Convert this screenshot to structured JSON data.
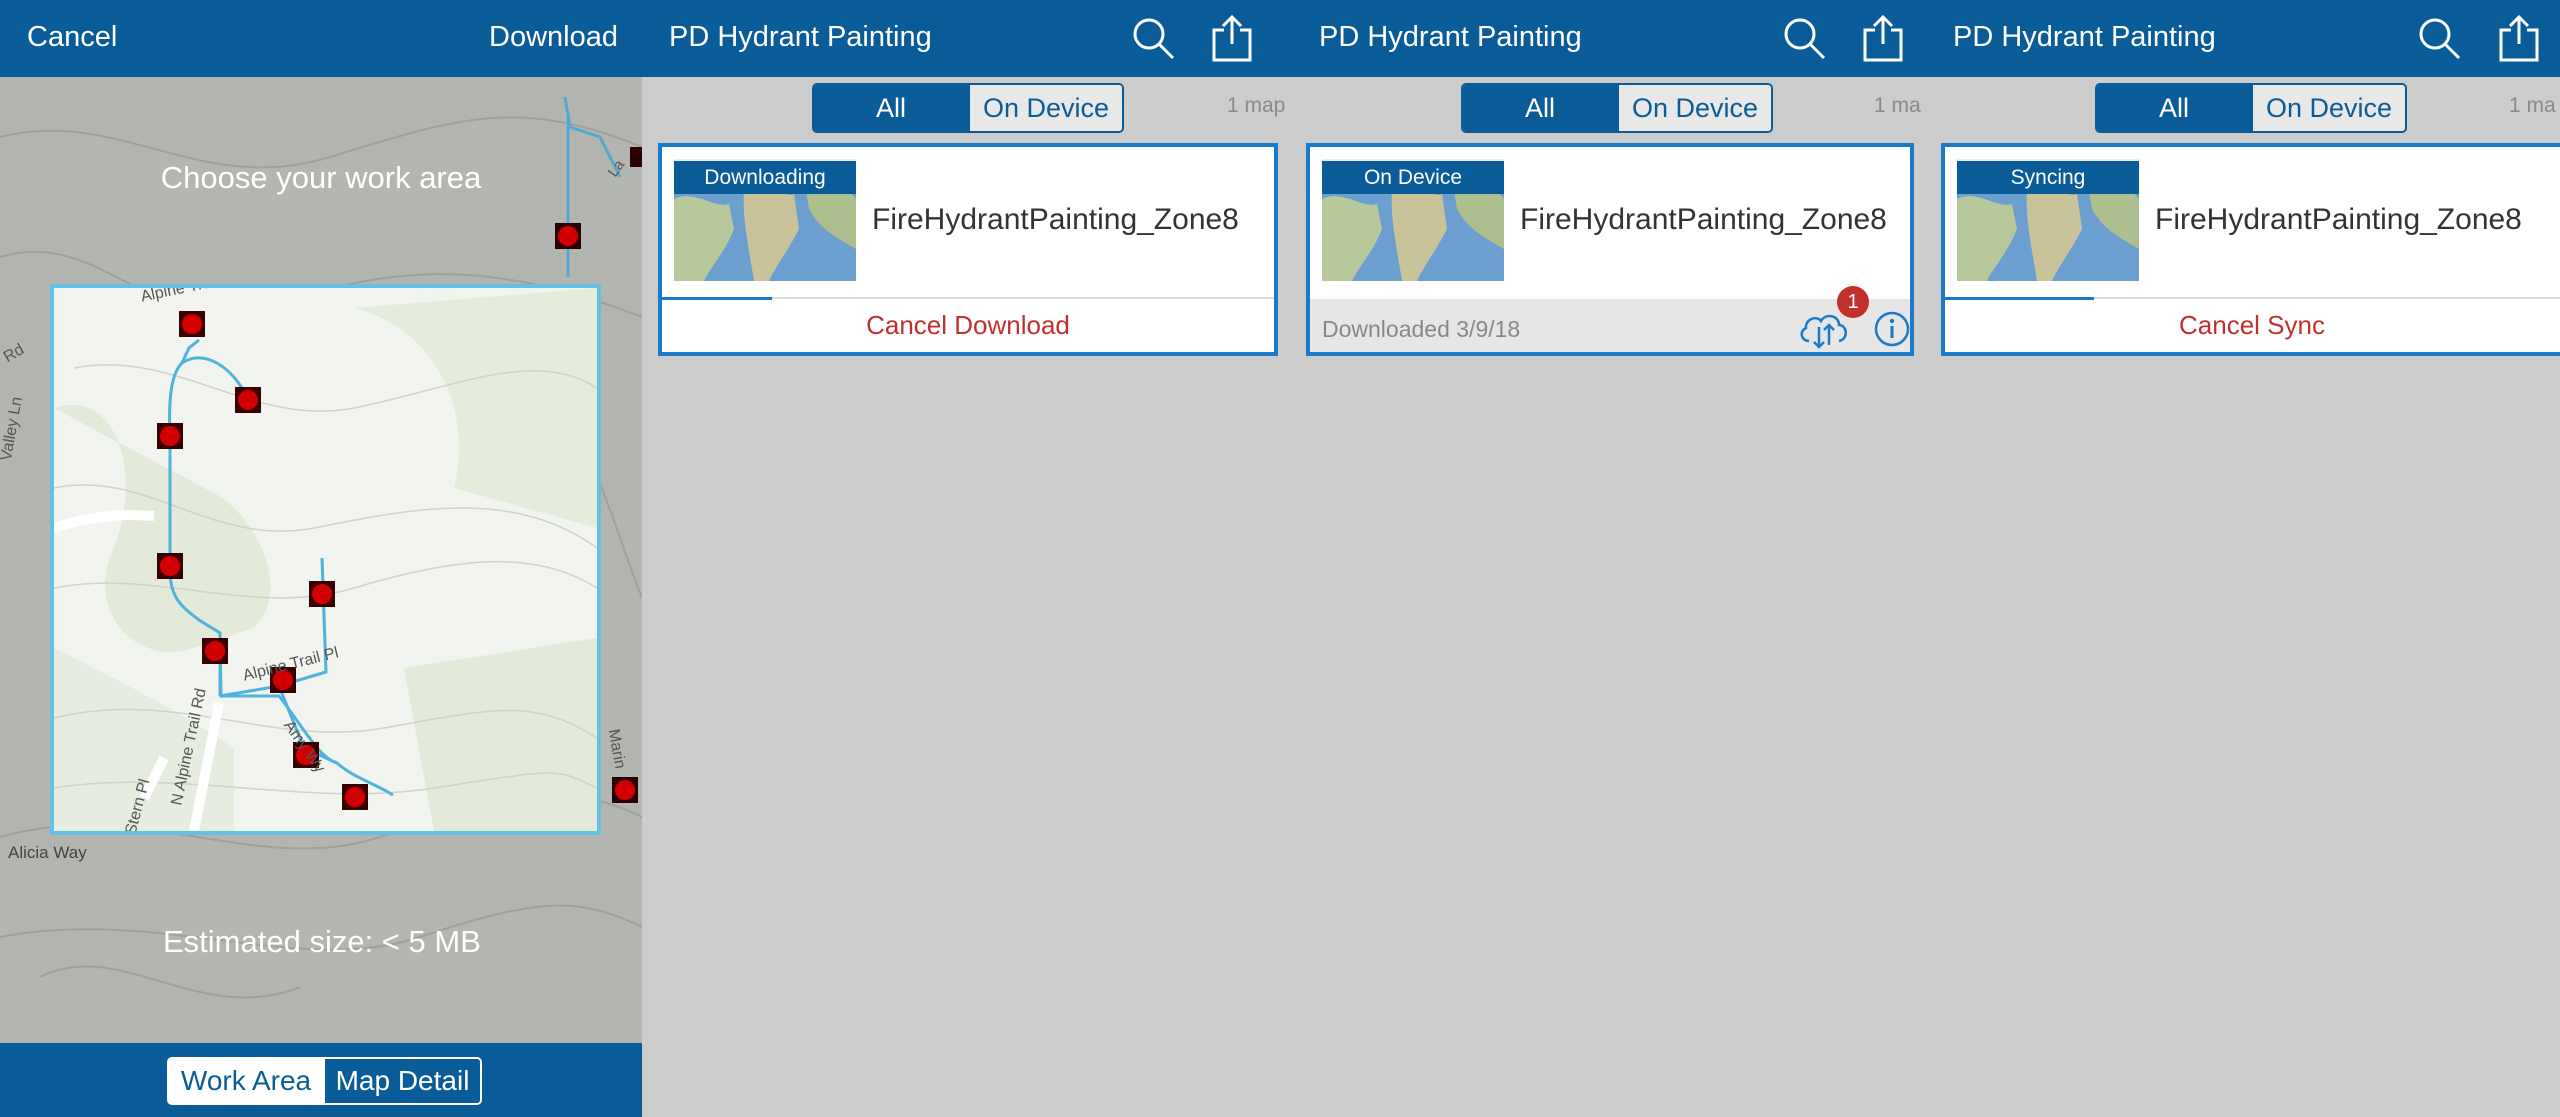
{
  "left_panel": {
    "cancel_label": "Cancel",
    "download_label": "Download",
    "instruction": "Choose your work area",
    "estimated_size": "Estimated size: < 5 MB",
    "bottom_tabs": {
      "work_area": "Work Area",
      "map_detail": "Map Detail"
    },
    "map_labels": {
      "alpine_trail_rd_top": "Alpine Trail Rd",
      "alpine_trail_pl": "Alpine Trail Pl",
      "n_alpine_trail_rd": "N Alpine Trail Rd",
      "alicia_way": "Alicia Way",
      "amy_way": "Amy Wy",
      "valley_ln": "Valley Ln",
      "marin": "Marin",
      "stern_pl": "Stern Pl",
      "la": "La",
      "rd": "Rd"
    }
  },
  "panels": [
    {
      "title": "PD Hydrant Painting",
      "segment": {
        "all": "All",
        "on_device": "On Device"
      },
      "count": "1 map",
      "card": {
        "badge": "Downloading",
        "name": "FireHydrantPainting_Zone8",
        "action": "Cancel Download",
        "progress": 0.18
      }
    },
    {
      "title": "PD Hydrant Painting",
      "segment": {
        "all": "All",
        "on_device": "On Device"
      },
      "count": "1 ma",
      "card": {
        "badge": "On Device",
        "name": "FireHydrantPainting_Zone8",
        "downloaded": "Downloaded 3/9/18",
        "sync_count": "1"
      }
    },
    {
      "title": "PD Hydrant Painting",
      "segment": {
        "all": "All",
        "on_device": "On Device"
      },
      "count": "1 ma",
      "card": {
        "badge": "Syncing",
        "name": "FireHydrantPainting_Zone8",
        "action": "Cancel Sync",
        "progress": 0.24
      }
    }
  ],
  "colors": {
    "brand_blue": "#0a5c99",
    "accent_blue": "#1a7ac7",
    "alert_red": "#c0312b"
  }
}
